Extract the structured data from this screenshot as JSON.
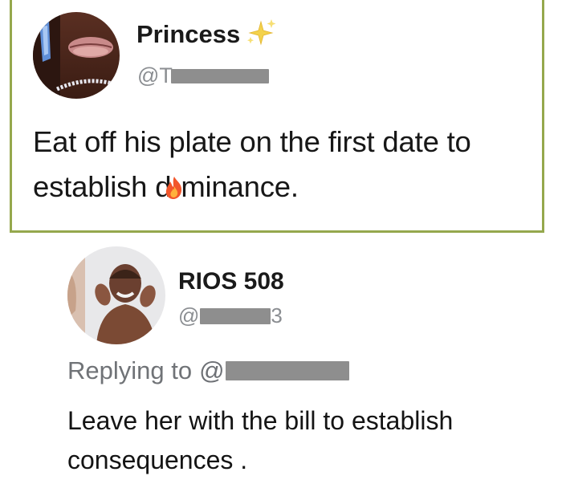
{
  "tweets": [
    {
      "display_name": "Princess",
      "name_emoji": "sparkles-icon",
      "handle_prefix": "@T",
      "handle_redacted": true,
      "text_before_emoji": "Eat off his plate on the first date to establish d",
      "inline_emoji": "fire-icon",
      "text_after_emoji": "minance.",
      "frame_color": "#95a84d"
    },
    {
      "display_name": "RIOS 508",
      "handle_prefix": "@",
      "handle_suffix": "3",
      "handle_redacted": true,
      "replying_label": "Replying to",
      "replying_mention_prefix": "@",
      "text": "Leave her with the bill to establish consequences ."
    }
  ],
  "colors": {
    "secondary_text": "#8b8e92",
    "primary_text": "#171717",
    "redaction": "#8e8e8e"
  }
}
